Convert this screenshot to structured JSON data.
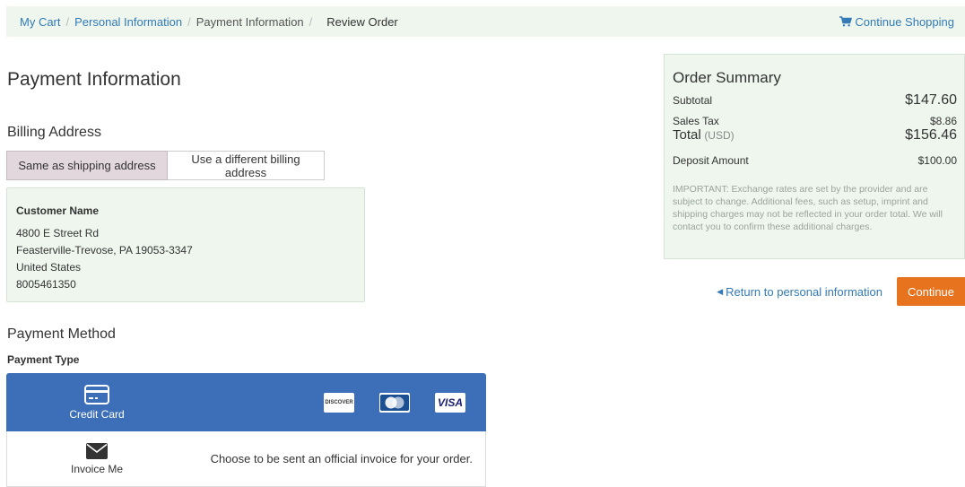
{
  "breadcrumb": {
    "items": [
      "My Cart",
      "Personal Information",
      "Payment Information",
      "Review Order"
    ],
    "continue_shopping": "Continue Shopping"
  },
  "page_title": "Payment Information",
  "billing": {
    "title": "Billing Address",
    "options": [
      "Same as shipping address",
      "Use a different billing address"
    ],
    "selected": "Same as shipping address",
    "address": {
      "name": "Customer Name",
      "street": "4800 E Street Rd",
      "city_line": "Feasterville-Trevose, PA 19053-3347",
      "country": "United States",
      "phone": "8005461350"
    }
  },
  "payment": {
    "title": "Payment Method",
    "type_label": "Payment Type",
    "options": [
      {
        "label": "Credit Card",
        "icon": "credit-card-icon",
        "selected": true,
        "cards": [
          "DISCOVER",
          "MasterCard",
          "VISA"
        ]
      },
      {
        "label": "Invoice Me",
        "icon": "envelope-icon",
        "selected": false,
        "description": "Choose to be sent an official invoice for your order."
      }
    ]
  },
  "summary": {
    "title": "Order Summary",
    "subtotal_label": "Subtotal",
    "subtotal": "$147.60",
    "tax_label": "Sales Tax",
    "tax": "$8.86",
    "total_label": "Total",
    "total_currency": "(USD)",
    "total": "$156.46",
    "deposit_label": "Deposit Amount",
    "deposit": "$100.00",
    "note": "IMPORTANT: Exchange rates are set by the provider and are subject to change. Additional fees, such as setup, imprint and shipping charges may not be reflected in your order total. We will contact you to confirm these additional charges."
  },
  "actions": {
    "return_label": "Return to personal information",
    "continue_label": "Continue"
  },
  "colors": {
    "accent": "#337ab7",
    "selected_payment": "#3d6fb8",
    "continue": "#e8731e",
    "panel": "#eef6ee"
  }
}
